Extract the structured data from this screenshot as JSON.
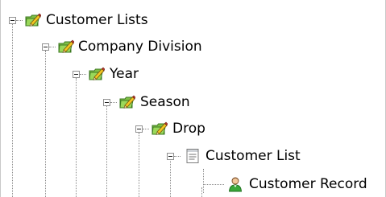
{
  "tree": {
    "nodes": [
      {
        "label": "Customer Lists",
        "icon": "pencil-folder-icon",
        "expanded": true
      },
      {
        "label": "Company Division",
        "icon": "pencil-folder-icon",
        "expanded": true
      },
      {
        "label": "Year",
        "icon": "pencil-folder-icon",
        "expanded": true
      },
      {
        "label": "Season",
        "icon": "pencil-folder-icon",
        "expanded": true
      },
      {
        "label": "Drop",
        "icon": "pencil-folder-icon",
        "expanded": true
      },
      {
        "label": "Customer List",
        "icon": "document-list-icon",
        "expanded": true
      },
      {
        "label": "Customer Record",
        "icon": "person-icon",
        "expanded": false
      }
    ]
  },
  "colors": {
    "background": "#ffffff",
    "tree_line": "#8c8c8c",
    "folder_green": "#72b83c",
    "pencil_yellow": "#f3c621",
    "person_green": "#3aa83a"
  }
}
